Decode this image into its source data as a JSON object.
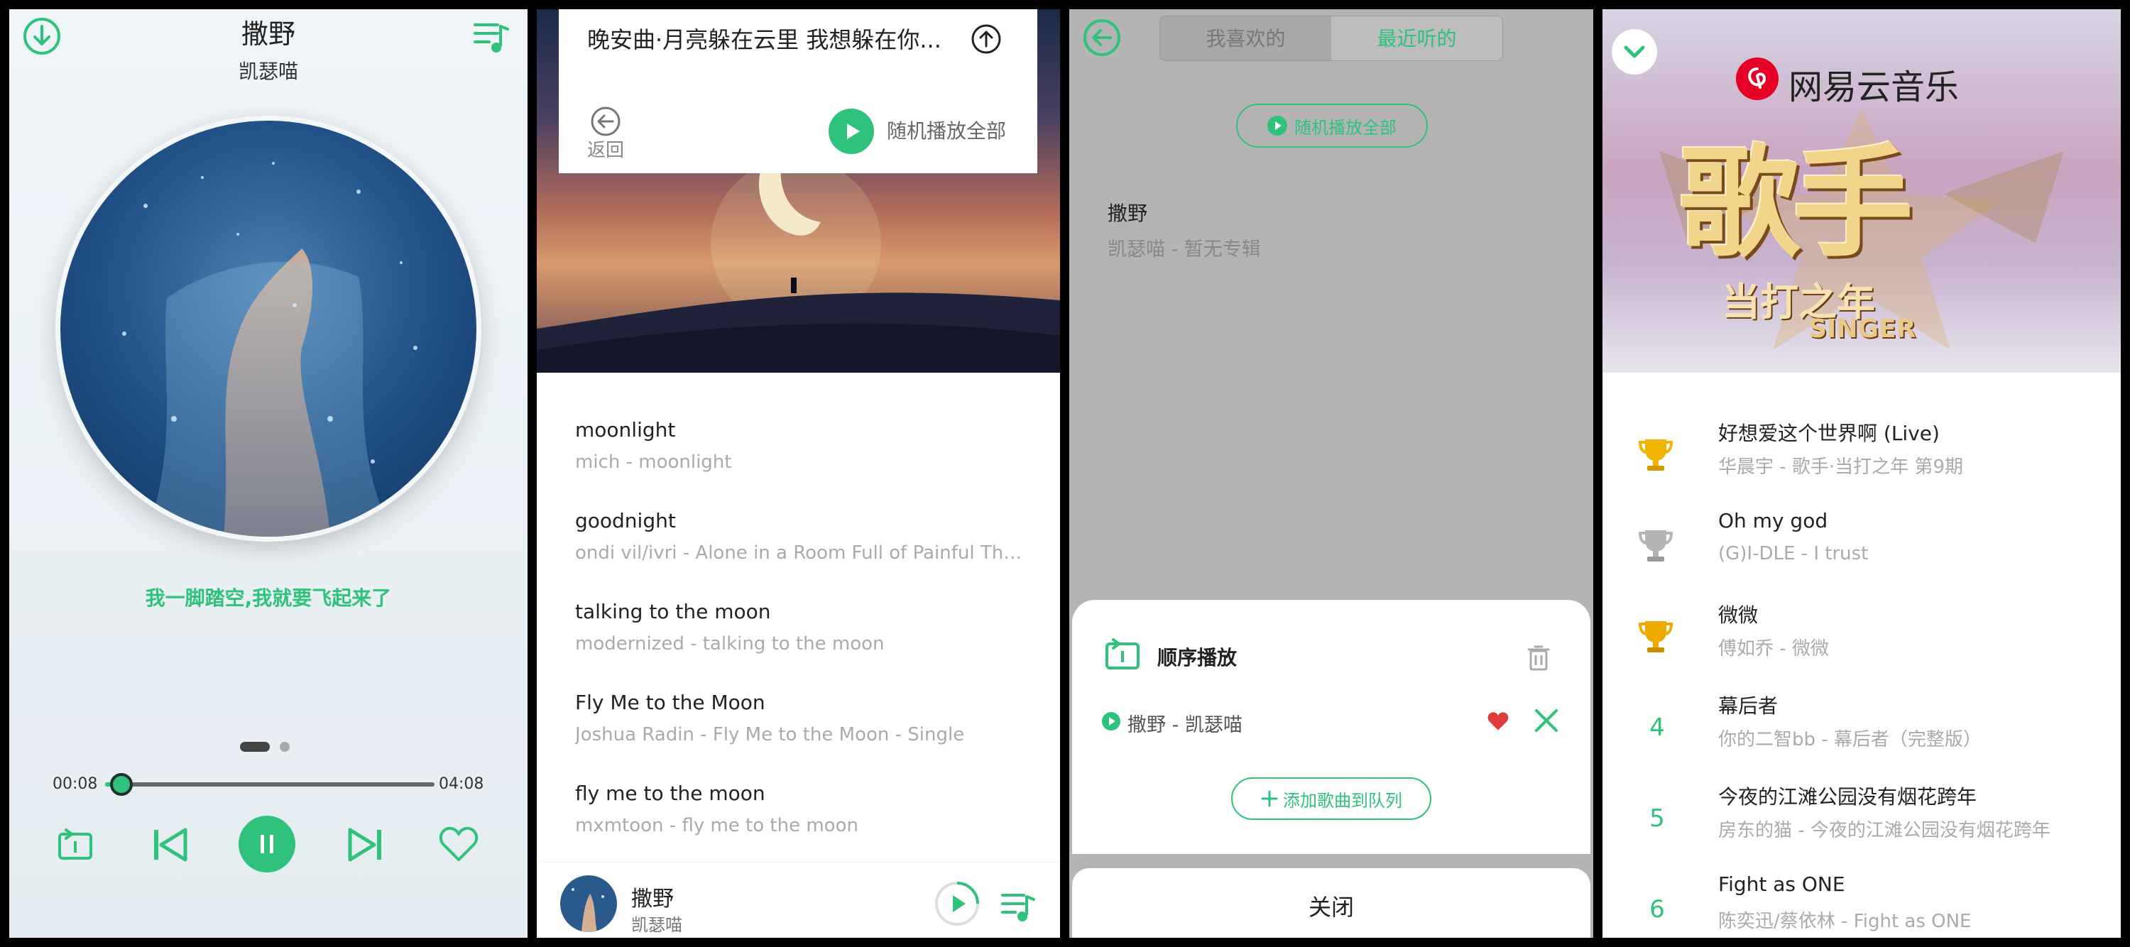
{
  "player": {
    "song_title": "撒野",
    "artist": "凯瑟喵",
    "lyric": "我一脚踏空,我就要飞起来了",
    "current_time": "00:08",
    "duration": "04:08",
    "progress": 0.032
  },
  "playlist_view": {
    "playlist_title": "晚安曲·月亮躲在云里 我想躲在你...",
    "back_label": "返回",
    "shuffle_label": "随机播放全部",
    "songs": [
      {
        "title": "moonlight",
        "subtitle": "mich - moonlight"
      },
      {
        "title": "goodnight",
        "subtitle": "ondi vil/ivri - Alone in a Room Full of Painful Tho..."
      },
      {
        "title": "talking to the moon",
        "subtitle": "modernized - talking to the moon"
      },
      {
        "title": "Fly Me to the Moon",
        "subtitle": "Joshua Radin - Fly Me to the Moon - Single"
      },
      {
        "title": "fly me to the moon",
        "subtitle": "mxmtoon - fly me to the moon"
      }
    ],
    "mini_player": {
      "title": "撒野",
      "artist": "凯瑟喵"
    }
  },
  "library_view": {
    "tabs": [
      "我喜欢的",
      "最近听的"
    ],
    "active_tab": 1,
    "shuffle_label": "随机播放全部",
    "recent_song": {
      "title": "撒野",
      "subtitle": "凯瑟喵 - 暂无专辑"
    },
    "queue": {
      "mode_label": "顺序播放",
      "current_item": "撒野 - 凯瑟喵",
      "add_label": "添加歌曲到队列",
      "close_label": "关闭"
    }
  },
  "chart_view": {
    "brand": "网易云音乐",
    "banner_title": "歌手",
    "banner_subtitle": "当打之年",
    "banner_tag": "SINGER",
    "items": [
      {
        "rank": "1",
        "badge": "gold-trophy",
        "title": "好想爱这个世界啊 (Live)",
        "subtitle": "华晨宇 - 歌手·当打之年 第9期"
      },
      {
        "rank": "2",
        "badge": "silver-trophy",
        "title": "Oh my god",
        "subtitle": "(G)I-DLE - I trust"
      },
      {
        "rank": "3",
        "badge": "bronze-trophy",
        "title": "微微",
        "subtitle": "傅如乔 - 微微"
      },
      {
        "rank": "4",
        "badge": "",
        "title": "幕后者",
        "subtitle": "你的二智bb - 幕后者（完整版）"
      },
      {
        "rank": "5",
        "badge": "",
        "title": "今夜的江滩公园没有烟花跨年",
        "subtitle": "房东的猫 - 今夜的江滩公园没有烟花跨年"
      },
      {
        "rank": "6",
        "badge": "",
        "title": "Fight as ONE",
        "subtitle": "陈奕迅/蔡依林 - Fight as ONE"
      }
    ]
  },
  "colors": {
    "accent": "#2ec27b",
    "heart": "#e03c3c",
    "gold": "#f0b400",
    "silver": "#b5b5b5"
  }
}
